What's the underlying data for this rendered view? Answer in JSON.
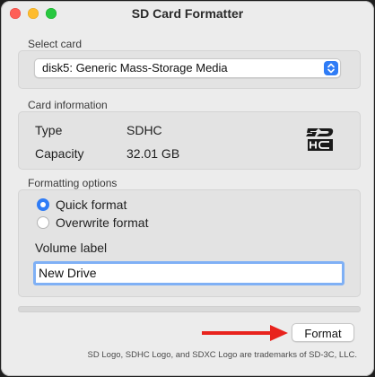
{
  "window": {
    "title": "SD Card Formatter"
  },
  "select_card": {
    "section_label": "Select card",
    "selected": "disk5: Generic Mass-Storage Media"
  },
  "card_info": {
    "section_label": "Card information",
    "type_label": "Type",
    "type_value": "SDHC",
    "capacity_label": "Capacity",
    "capacity_value": "32.01 GB",
    "logo_icon": "sdhc-logo-icon"
  },
  "formatting": {
    "section_label": "Formatting options",
    "quick_format_label": "Quick format",
    "overwrite_format_label": "Overwrite format",
    "selected_option": "quick",
    "volume_label_caption": "Volume label",
    "volume_label_value": "New Drive"
  },
  "progress": {
    "fraction": 0
  },
  "actions": {
    "format_label": "Format"
  },
  "annotation": {
    "arrow_color": "#e8231d"
  },
  "footer": {
    "text": "SD Logo, SDHC Logo, and SDXC Logo are trademarks of SD-3C, LLC."
  },
  "colors": {
    "accent": "#2f7cf6",
    "close": "#fe5f57",
    "minimize": "#febc2e",
    "maximize": "#28c840"
  }
}
